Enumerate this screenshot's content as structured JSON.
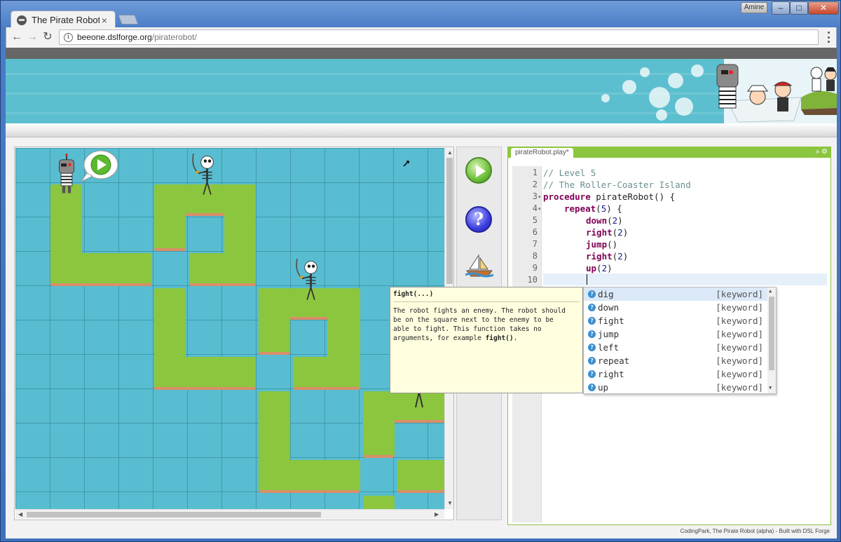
{
  "window": {
    "tab_title": "The Pirate Robot",
    "tab_close": "×",
    "user_name": "Amine",
    "min_glyph": "–",
    "max_glyph": "□",
    "close_glyph": "✕"
  },
  "browser": {
    "back": "←",
    "forward": "→",
    "reload": "↻",
    "info": "i",
    "url_host": "beeone.dslforge.org",
    "url_path": "/piraterobot/"
  },
  "toolbar_colors": {
    "accent": "#8cc63f",
    "water": "#58bdd0"
  },
  "tools": {
    "help_glyph": "?"
  },
  "editor": {
    "tab_label": "pirateRobot.play*",
    "tab_icons": "» ⚙",
    "lines": [
      "1",
      "2",
      "3",
      "4",
      "5",
      "6",
      "7",
      "8",
      "9",
      "10"
    ],
    "code": {
      "l1": "// Level 5",
      "l2": "// The Roller-Coaster Island",
      "l3_kw": "procedure",
      "l3_rest": " pirateRobot() {",
      "l4_kw": "repeat",
      "l4_open": "(",
      "l4_num": "5",
      "l4_close": ") {",
      "l5_fn": "down",
      "l5_num": "2",
      "l6_fn": "right",
      "l6_num": "2",
      "l7_fn": "jump",
      "l7_rest": "()",
      "l8_fn": "right",
      "l8_num": "2",
      "l9_fn": "up",
      "l9_num": "2"
    }
  },
  "tooltip": {
    "title": "fight(...)",
    "body_line1": "The robot fights an enemy. The robot should",
    "body_line2": "be on the square next to the enemy to be",
    "body_line3": "able to fight. This function takes no",
    "body_line4_pre": "arguments, for example ",
    "body_line4_code": "fight()",
    "body_line4_post": "."
  },
  "autocomplete": {
    "items": [
      {
        "name": "dig",
        "kind": "[keyword]"
      },
      {
        "name": "down",
        "kind": "[keyword]"
      },
      {
        "name": "fight",
        "kind": "[keyword]"
      },
      {
        "name": "jump",
        "kind": "[keyword]"
      },
      {
        "name": "left",
        "kind": "[keyword]"
      },
      {
        "name": "repeat",
        "kind": "[keyword]"
      },
      {
        "name": "right",
        "kind": "[keyword]"
      },
      {
        "name": "up",
        "kind": "[keyword]"
      }
    ]
  },
  "footer": {
    "text": "CodingPark, The Pirate Robot (alpha) - Built with DSL Forge"
  }
}
